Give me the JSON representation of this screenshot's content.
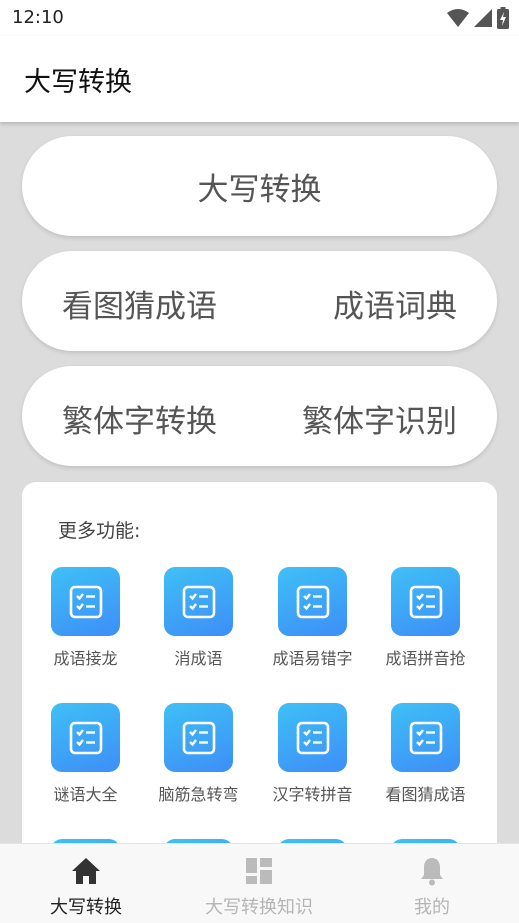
{
  "status_bar": {
    "time": "12:10",
    "icons": [
      "wifi-icon",
      "signal-icon",
      "battery-charging-icon"
    ]
  },
  "app_bar": {
    "title": "大写转换"
  },
  "buttons": {
    "uppercase": "大写转换",
    "guess_idiom": "看图猜成语",
    "idiom_dictionary": "成语词典",
    "traditional_convert": "繁体字转换",
    "traditional_recognize": "繁体字识别"
  },
  "more": {
    "title": "更多功能:",
    "items": [
      {
        "label": "成语接龙",
        "icon": "checklist-icon"
      },
      {
        "label": "消成语",
        "icon": "checklist-icon"
      },
      {
        "label": "成语易错字",
        "icon": "checklist-icon"
      },
      {
        "label": "成语拼音抢",
        "icon": "checklist-icon"
      },
      {
        "label": "谜语大全",
        "icon": "checklist-icon"
      },
      {
        "label": "脑筋急转弯",
        "icon": "checklist-icon"
      },
      {
        "label": "汉字转拼音",
        "icon": "checklist-icon"
      },
      {
        "label": "看图猜成语",
        "icon": "checklist-icon"
      }
    ]
  },
  "bottom_nav": {
    "items": [
      {
        "label": "大写转换",
        "icon": "home-icon",
        "active": true
      },
      {
        "label": "大写转换知识",
        "icon": "dashboard-icon",
        "active": false
      },
      {
        "label": "我的",
        "icon": "bell-icon",
        "active": false
      }
    ]
  },
  "colors": {
    "accent_gradient_top": "#3fc0f6",
    "accent_gradient_bottom": "#3d8ef7",
    "background": "#dcdcdc"
  }
}
